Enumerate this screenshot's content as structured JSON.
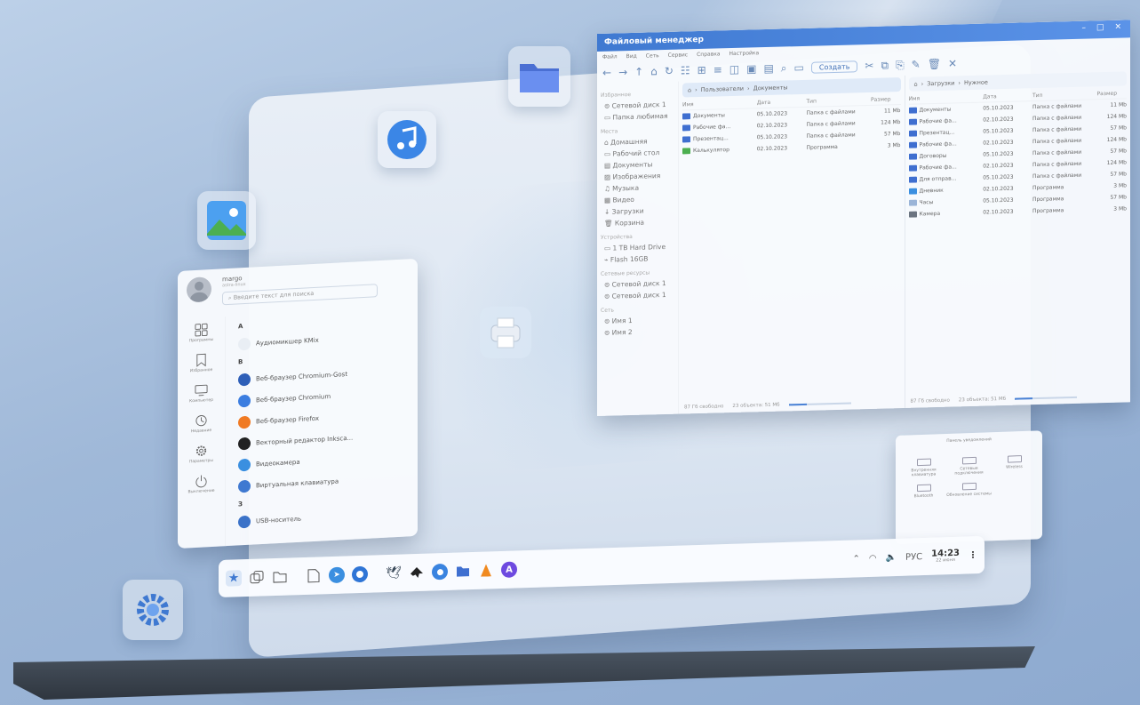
{
  "file_manager": {
    "title": "Файловый менеджер",
    "menu": [
      "Файл",
      "Вид",
      "Сеть",
      "Сервис",
      "Справка",
      "Настройка"
    ],
    "create_label": "Создать",
    "sidebar": {
      "favorites_header": "Избранное",
      "favorites": [
        "Сетевой диск 1",
        "Папка любимая"
      ],
      "places_header": "Места",
      "places": [
        "Домашняя",
        "Рабочий стол",
        "Документы",
        "Изображения",
        "Музыка",
        "Видео",
        "Загрузки",
        "Корзина"
      ],
      "devices_header": "Устройства",
      "devices": [
        "1 TB Hard Drive",
        "Flash 16GB"
      ],
      "network_res_header": "Сетевые ресурсы",
      "network_res": [
        "Сетевой диск 1",
        "Сетевой диск 1"
      ],
      "net_header": "Сеть",
      "net": [
        "Имя 1",
        "Имя 2"
      ]
    },
    "left_pane": {
      "breadcrumb": [
        "Пользователи",
        "Документы"
      ],
      "columns": [
        "Имя",
        "Дата",
        "Тип",
        "Размер"
      ],
      "rows": [
        {
          "name": "Документы",
          "date": "05.10.2023",
          "type": "Папка с файлами",
          "size": "11 Mb",
          "icon": "folder"
        },
        {
          "name": "Рабочие фа...",
          "date": "02.10.2023",
          "type": "Папка с файлами",
          "size": "124 Mb",
          "icon": "folder"
        },
        {
          "name": "Презентац...",
          "date": "05.10.2023",
          "type": "Папка с файлами",
          "size": "57 Mb",
          "icon": "folder"
        },
        {
          "name": "Калькулятор",
          "date": "02.10.2023",
          "type": "Программа",
          "size": "3 Mb",
          "icon": "calculator"
        }
      ],
      "footer_free": "87 Гб свободно",
      "footer_count": "23 объекта: 51 Мб"
    },
    "right_pane": {
      "breadcrumb": [
        "Загрузки",
        "Нужное"
      ],
      "columns": [
        "Имя",
        "Дата",
        "Тип",
        "Размер"
      ],
      "rows": [
        {
          "name": "Документы",
          "date": "05.10.2023",
          "type": "Папка с файлами",
          "size": "11 Mb",
          "icon": "folder"
        },
        {
          "name": "Рабочие фа...",
          "date": "02.10.2023",
          "type": "Папка с файлами",
          "size": "124 Mb",
          "icon": "folder"
        },
        {
          "name": "Презентац...",
          "date": "05.10.2023",
          "type": "Папка с файлами",
          "size": "57 Mb",
          "icon": "folder"
        },
        {
          "name": "Рабочие фа...",
          "date": "02.10.2023",
          "type": "Папка с файлами",
          "size": "124 Mb",
          "icon": "folder"
        },
        {
          "name": "Договоры",
          "date": "05.10.2023",
          "type": "Папка с файлами",
          "size": "57 Mb",
          "icon": "folder"
        },
        {
          "name": "Рабочие фа...",
          "date": "02.10.2023",
          "type": "Папка с файлами",
          "size": "124 Mb",
          "icon": "folder"
        },
        {
          "name": "Для отправ...",
          "date": "05.10.2023",
          "type": "Папка с файлами",
          "size": "57 Mb",
          "icon": "folder"
        },
        {
          "name": "Дневник",
          "date": "02.10.2023",
          "type": "Программа",
          "size": "3 Mb",
          "icon": "app"
        },
        {
          "name": "Часы",
          "date": "05.10.2023",
          "type": "Программа",
          "size": "57 Mb",
          "icon": "clock"
        },
        {
          "name": "Камера",
          "date": "02.10.2023",
          "type": "Программа",
          "size": "3 Mb",
          "icon": "camera"
        }
      ],
      "footer_free": "87 Гб свободно",
      "footer_count": "23 объекта: 51 Мб"
    }
  },
  "start_menu": {
    "user_name": "margo",
    "user_sub": "astra-linux",
    "search_placeholder": "Введите текст для поиска",
    "nav": [
      "Программы",
      "Избранное",
      "Компьютер",
      "Недавние",
      "Параметры",
      "Выключение"
    ],
    "groups": [
      {
        "letter": "А",
        "apps": [
          {
            "label": "Аудиомикшер KMix",
            "color": "#e9eef4"
          }
        ]
      },
      {
        "letter": "В",
        "apps": [
          {
            "label": "Веб-браузер Chromium-Gost",
            "color": "#2e5fb8"
          },
          {
            "label": "Веб-браузер Chromium",
            "color": "#3b7de0"
          },
          {
            "label": "Веб-браузер Firefox",
            "color": "#f07a23"
          },
          {
            "label": "Векторный редактор Inksca...",
            "color": "#222222"
          },
          {
            "label": "Видеокамера",
            "color": "#3a8fe0"
          },
          {
            "label": "Виртуальная клавиатура",
            "color": "#3f79d1"
          }
        ]
      },
      {
        "letter": "З",
        "apps": [
          {
            "label": "USB-носитель",
            "color": "#3a72c8"
          }
        ]
      }
    ]
  },
  "notifications": {
    "title": "Панель уведомлений",
    "items": [
      "Внутренняя клавиатура",
      "Сетевые подключения",
      "Wireless",
      "Bluetooth",
      "Обновление системы"
    ]
  },
  "taskbar": {
    "apps": [
      "start-icon",
      "windows-icon",
      "folder-icon",
      "document-icon",
      "telegram-icon",
      "browser-icon",
      "bird-icon",
      "inkscape-icon",
      "chromium-icon",
      "file-manager-icon",
      "vlc-icon",
      "store-icon"
    ],
    "lang": "РУС",
    "time": "14:23",
    "date": "22 июня"
  },
  "colors": {
    "accent": "#3f79d1",
    "folder": "#3f6fd0"
  }
}
